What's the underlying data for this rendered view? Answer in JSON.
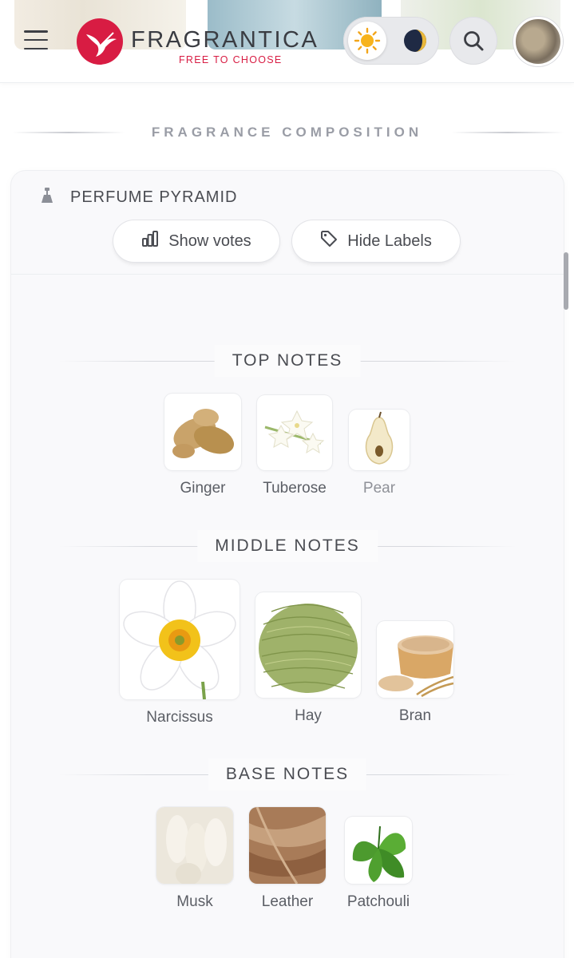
{
  "header": {
    "logo_text": "FRAGRANTICA",
    "logo_tagline": "FREE TO CHOOSE",
    "brand_color": "#d81c43"
  },
  "section": {
    "title": "FRAGRANCE COMPOSITION"
  },
  "pyramid": {
    "title": "PERFUME PYRAMID",
    "show_votes_label": "Show votes",
    "hide_labels_label": "Hide Labels"
  },
  "notes": {
    "top": {
      "title": "TOP NOTES",
      "items": [
        {
          "name": "Ginger",
          "icon": "ginger-image"
        },
        {
          "name": "Tuberose",
          "icon": "tuberose-image"
        },
        {
          "name": "Pear",
          "icon": "pear-image"
        }
      ]
    },
    "middle": {
      "title": "MIDDLE NOTES",
      "items": [
        {
          "name": "Narcissus",
          "icon": "narcissus-image"
        },
        {
          "name": "Hay",
          "icon": "hay-image"
        },
        {
          "name": "Bran",
          "icon": "bran-image"
        }
      ]
    },
    "base": {
      "title": "BASE NOTES",
      "items": [
        {
          "name": "Musk",
          "icon": "musk-image"
        },
        {
          "name": "Leather",
          "icon": "leather-image"
        },
        {
          "name": "Patchouli",
          "icon": "patchouli-image"
        }
      ]
    }
  }
}
